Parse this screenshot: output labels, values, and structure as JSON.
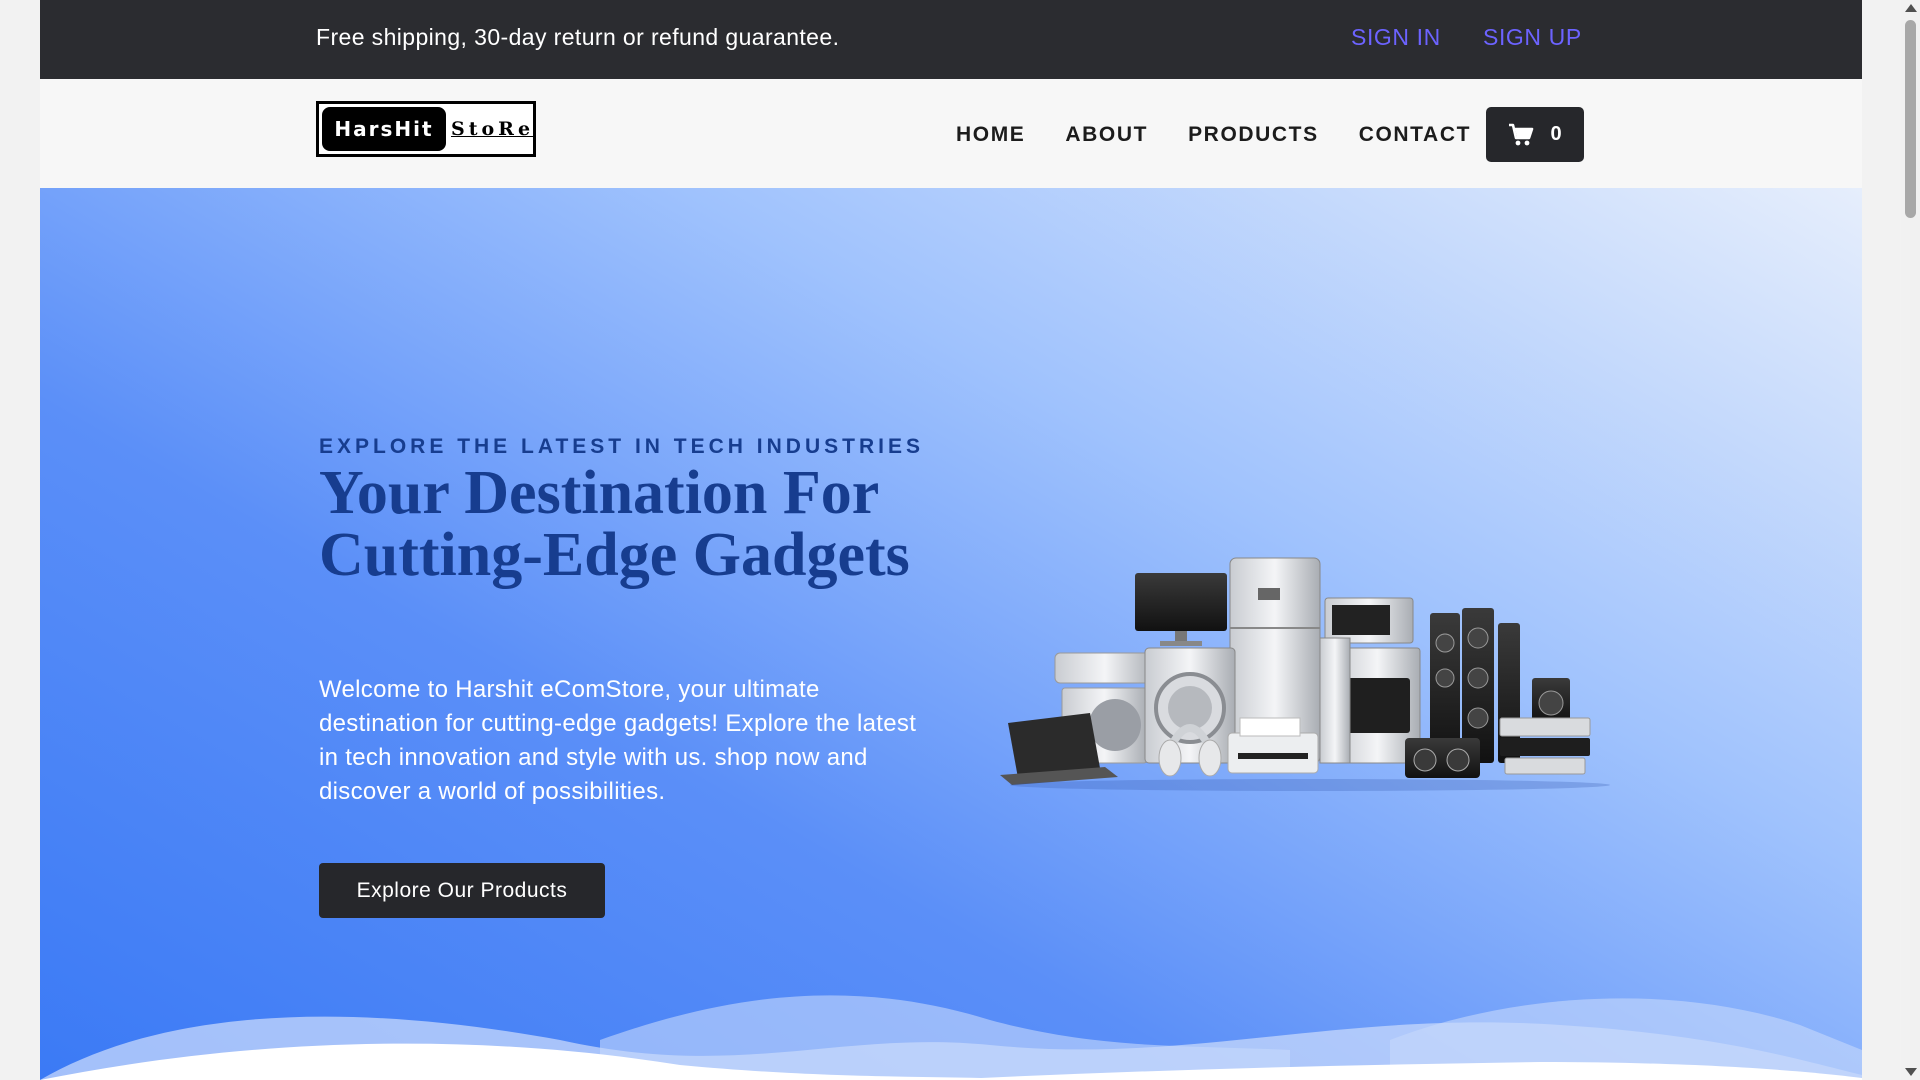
{
  "topbar": {
    "promo": "Free shipping, 30-day return or refund guarantee.",
    "sign_in": "SIGN IN",
    "sign_up": "SIGN UP"
  },
  "header": {
    "logo_dark": "HarsHit",
    "logo_light": "StoRe",
    "nav": [
      "HOME",
      "ABOUT",
      "PRODUCTS",
      "CONTACT"
    ],
    "cart_icon": "shopping-cart-icon",
    "cart_count": "0"
  },
  "hero": {
    "eyebrow": "EXPLORE THE LATEST IN TECH INDUSTRIES",
    "headline": "Your Destination For Cutting-Edge Gadgets",
    "description": "Welcome to Harshit eComStore, your ultimate destination for cutting-edge gadgets! Explore the latest in tech innovation and style with us. shop now and discover a world of possibilities.",
    "cta": "Explore Our Products"
  },
  "colors": {
    "topbar_bg": "#2b2c30",
    "auth_link": "#6c63ff",
    "hero_primary": "#3b7af5",
    "headline": "#173d8f",
    "button_bg": "#26272b"
  }
}
